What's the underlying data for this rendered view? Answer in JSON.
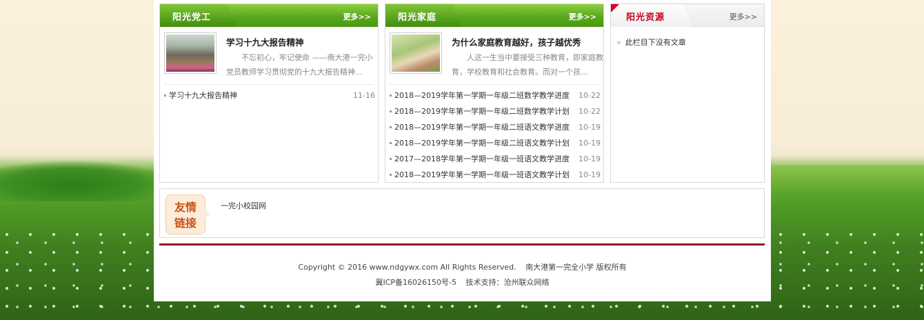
{
  "panels": {
    "party": {
      "title": "阳光党工",
      "more": "更多>>",
      "feature": {
        "title": "学习十九大报告精神",
        "desc": "不忘初心，牢记使命 ——南大港一完小党员教师学习贯彻党的十九大报告精神..."
      },
      "items": [
        {
          "title": "学习十九大报告精神",
          "date": "11-16"
        }
      ]
    },
    "family": {
      "title": "阳光家庭",
      "more": "更多>>",
      "feature": {
        "title": "为什么家庭教育越好，孩子越优秀",
        "desc": "人这一生当中要接受三种教育，即家庭教育，学校教育和社会教育。而对一个孩..."
      },
      "items": [
        {
          "title": "2018—2019学年第一学期一年级二班数学教学进度",
          "date": "10-22"
        },
        {
          "title": "2018—2019学年第一学期一年级二班数学教学计划",
          "date": "10-22"
        },
        {
          "title": "2018—2019学年第一学期一年级二班语文教学进度",
          "date": "10-19"
        },
        {
          "title": "2018—2019学年第一学期一年级二班语文教学计划",
          "date": "10-19"
        },
        {
          "title": "2017—2018学年第一学期一年级一班语文教学进度",
          "date": "10-19"
        },
        {
          "title": "2018—2019学年第一学期一年级一班语文教学计划",
          "date": "10-19"
        }
      ]
    },
    "resources": {
      "title": "阳光资源",
      "more": "更多>>",
      "empty_arrow": "»",
      "empty_text": "此栏目下没有文章"
    }
  },
  "links": {
    "badge_line1": "友情",
    "badge_line2": "链接",
    "items": [
      "一完小校园网"
    ]
  },
  "footer": {
    "copyright": "Copyright © 2016 www.ndgywx.com All Rights Reserved.",
    "owner": "南大港第一完全小学 版权所有",
    "icp": "冀ICP备16026150号-5",
    "support": "技术支持：沧州联众网络"
  },
  "colors": {
    "green_header": "#5aa81c",
    "accent_red": "#c4001b",
    "divider": "#8a1a22",
    "badge_text": "#c8551a"
  }
}
